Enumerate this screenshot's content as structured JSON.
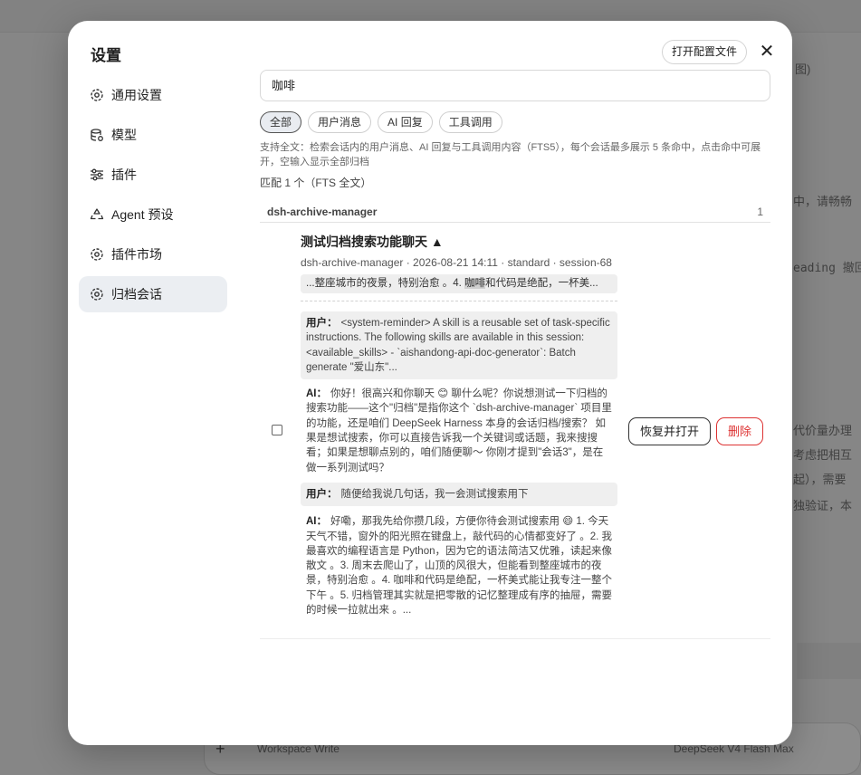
{
  "background": {
    "snippets": [
      "图)",
      "中，请畅畅",
      "eading 撤回",
      "代价量办理",
      "考虑把相互",
      "起），需要",
      "独验证，本"
    ],
    "input_bar": {
      "workspace_label": "Workspace Write",
      "model_label": "DeepSeek V4 Flash Max"
    }
  },
  "modal": {
    "title": "设置",
    "open_config_label": "打开配置文件",
    "close_symbol": "✕"
  },
  "sidebar": {
    "items": [
      {
        "label": "通用设置",
        "icon": "gear-icon"
      },
      {
        "label": "模型",
        "icon": "database-icon"
      },
      {
        "label": "插件",
        "icon": "sliders-icon"
      },
      {
        "label": "Agent 预设",
        "icon": "recycle-icon"
      },
      {
        "label": "插件市场",
        "icon": "gear-icon"
      },
      {
        "label": "归档会话",
        "icon": "gear-icon",
        "active": true
      }
    ]
  },
  "search": {
    "value": "咖啡"
  },
  "filters": [
    {
      "label": "全部",
      "active": true
    },
    {
      "label": "用户消息"
    },
    {
      "label": "AI 回复"
    },
    {
      "label": "工具调用"
    }
  ],
  "hint": "支持全文：检索会话内的用户消息、AI 回复与工具调用内容（FTS5），每个会话最多展示 5 条命中，点击命中可展开，空输入显示全部归档",
  "match_count": "匹配 1 个（FTS 全文）",
  "group": {
    "name": "dsh-archive-manager",
    "count": "1"
  },
  "session": {
    "title": "测试归档搜索功能聊天 ▲",
    "meta": "dsh-archive-manager · 2026-08-21 14:11 · standard · session-68",
    "snippet_before": "...整座城市的夜景，特别治愈 。4. ",
    "snippet_highlight": "咖啡",
    "snippet_after": "和代码是绝配，一杯美...",
    "messages": [
      {
        "role": "用户：",
        "type": "user",
        "text": "<system-reminder> A skill is a reusable set of task-specific instructions. The following skills are available in this session: <available_skills> - `aishandong-api-doc-generator`: Batch generate \"爱山东\"..."
      },
      {
        "role": "AI：",
        "type": "ai",
        "text": "你好！很高兴和你聊天 😊 聊什么呢？你说想测试一下归档的搜索功能——这个\"归档\"是指你这个 `dsh-archive-manager` 项目里的功能，还是咱们 DeepSeek Harness 本身的会话归档/搜索？ 如果是想试搜索，你可以直接告诉我一个关键词或话题，我来搜搜看；如果是想聊点别的，咱们随便聊～ 你刚才提到\"会话3\"，是在做一系列测试吗？"
      },
      {
        "role": "用户：",
        "type": "user",
        "text": "随便给我说几句话，我一会测试搜索用下"
      },
      {
        "role": "AI：",
        "type": "ai",
        "text": "好嘞，那我先给你攒几段，方便你待会测试搜索用 😄 1. 今天天气不错，窗外的阳光照在键盘上，敲代码的心情都变好了 。2. 我最喜欢的编程语言是 Python，因为它的语法简洁又优雅，读起来像散文 。3. 周末去爬山了，山顶的风很大，但能看到整座城市的夜景，特别治愈 。4. 咖啡和代码是绝配，一杯美式能让我专注一整个下午 。5. 归档管理其实就是把零散的记忆整理成有序的抽屉，需要的时候一拉就出来 。..."
      }
    ],
    "restore_label": "恢复并打开",
    "delete_label": "删除"
  }
}
